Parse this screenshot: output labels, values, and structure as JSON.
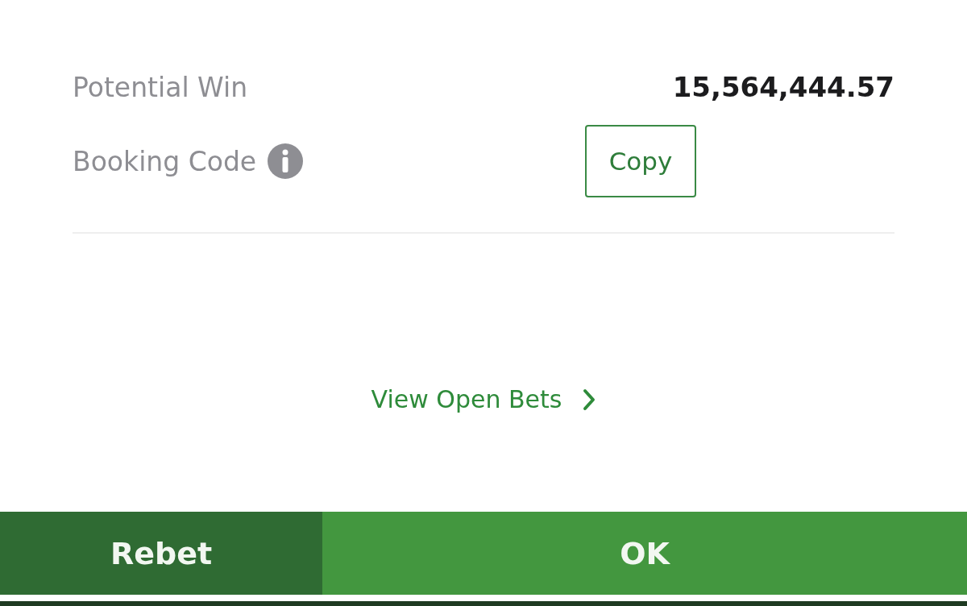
{
  "summary": [
    {
      "kind": "value",
      "label": "Potential Win",
      "value": "15,564,444.57"
    },
    {
      "kind": "booking",
      "label": "Booking Code",
      "button": "Copy"
    }
  ],
  "link": {
    "label": "View Open Bets"
  },
  "actions": [
    {
      "label": "Rebet",
      "primary": false
    },
    {
      "label": "OK",
      "primary": true
    }
  ]
}
